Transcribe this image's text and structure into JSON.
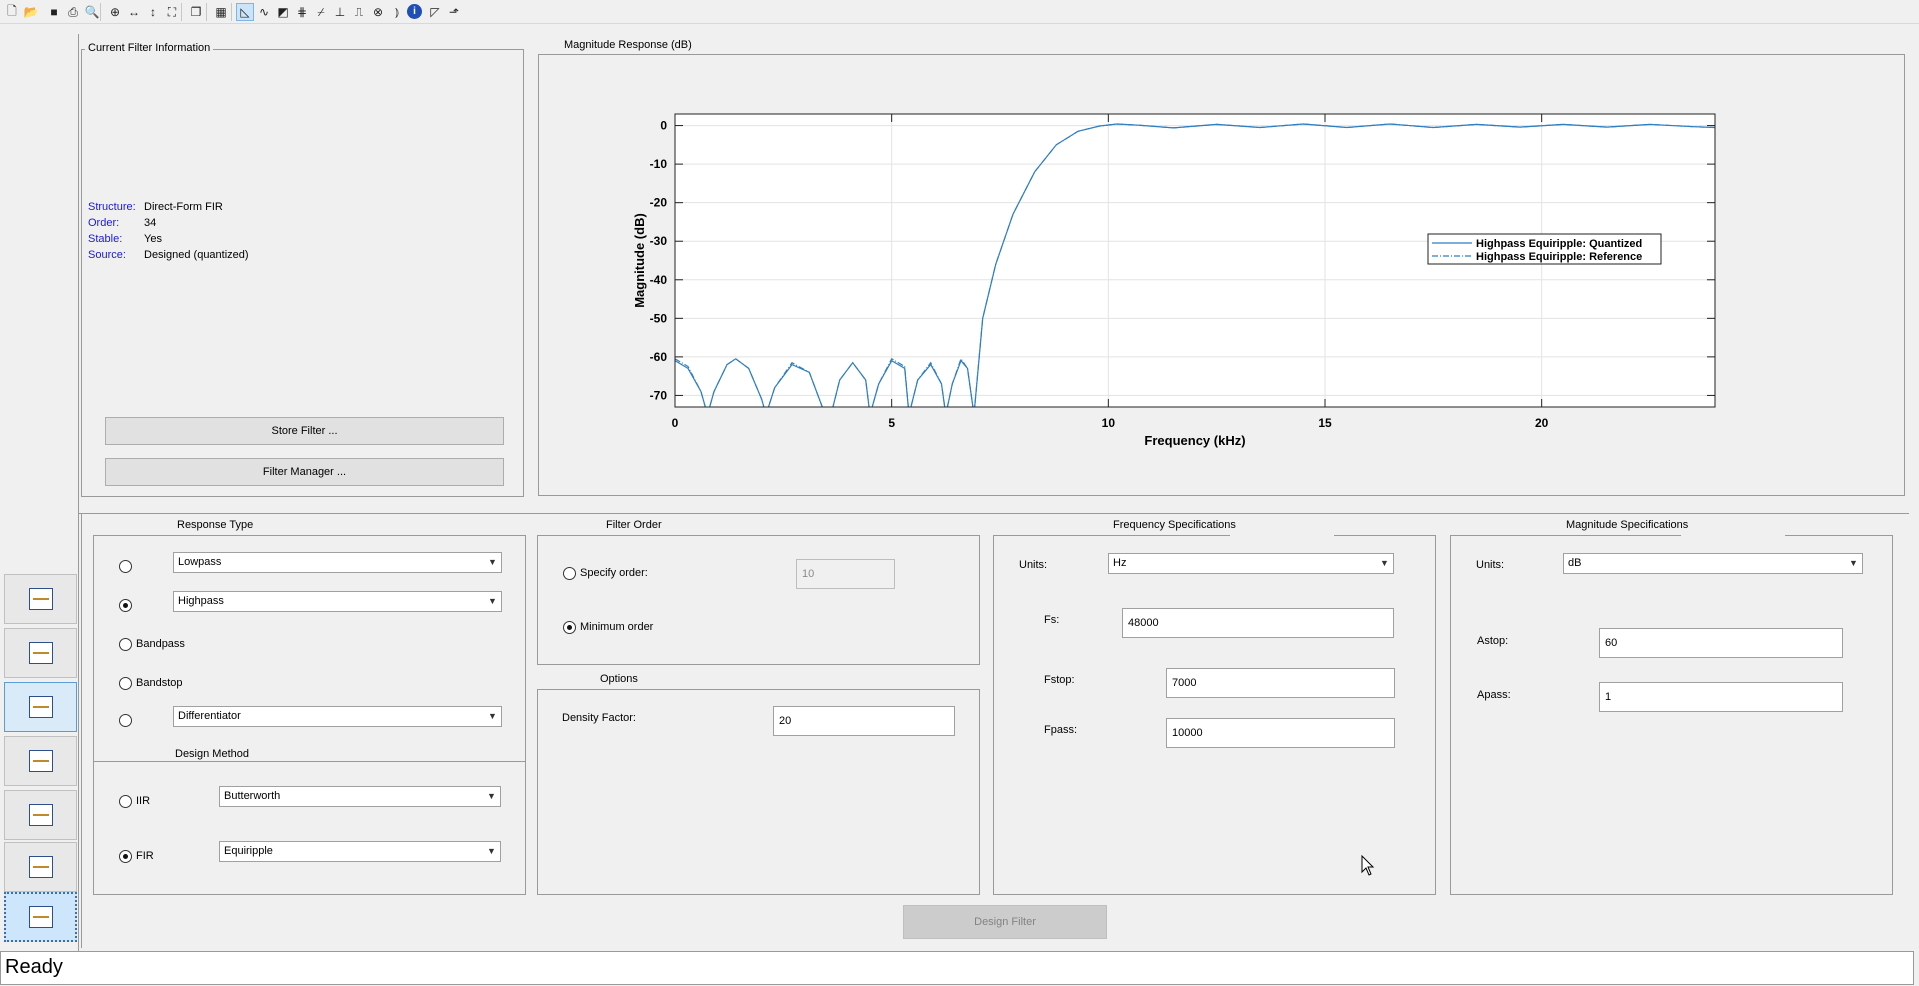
{
  "toolbar": {
    "icons": [
      "new-file-icon",
      "open-folder-icon",
      "save-icon",
      "print-icon",
      "print-preview-icon",
      "zoom-in-icon",
      "zoom-x-icon",
      "zoom-y-icon",
      "full-view-icon",
      "new-figure-icon",
      "filter-specs-icon",
      "magnitude-response-icon",
      "phase-response-icon",
      "magnitude-phase-icon",
      "group-delay-icon",
      "phase-delay-icon",
      "impulse-response-icon",
      "step-response-icon",
      "pole-zero-icon",
      "filter-coefficients-icon",
      "filter-information-icon",
      "magnitude-estimate-icon",
      "round-off-noise-icon"
    ]
  },
  "current_filter_info": {
    "title": "Current Filter Information",
    "rows": [
      {
        "label": "Structure:",
        "value": "Direct-Form FIR"
      },
      {
        "label": "Order:",
        "value": "34"
      },
      {
        "label": "Stable:",
        "value": "Yes"
      },
      {
        "label": "Source:",
        "value": "Designed (quantized)"
      }
    ],
    "store_filter": "Store Filter ...",
    "filter_manager": "Filter Manager ..."
  },
  "magnitude_panel": {
    "title": "Magnitude Response (dB)"
  },
  "chart_data": {
    "type": "line",
    "title": "",
    "xlabel": "Frequency (kHz)",
    "ylabel": "Magnitude (dB)",
    "xlim": [
      0,
      24
    ],
    "ylim": [
      -73,
      3
    ],
    "xticks": [
      0,
      5,
      10,
      15,
      20
    ],
    "yticks": [
      0,
      -10,
      -20,
      -30,
      -40,
      -50,
      -60,
      -70
    ],
    "grid": true,
    "legend_position": "right",
    "series": [
      {
        "name": "Highpass Equiripple: Quantized",
        "style": "solid",
        "color": "#2f7fc1",
        "x": [
          0,
          0.3,
          0.6,
          0.75,
          0.9,
          1.2,
          1.4,
          1.7,
          2.0,
          2.1,
          2.3,
          2.7,
          3.1,
          3.4,
          3.6,
          3.8,
          4.1,
          4.4,
          4.5,
          4.7,
          5.0,
          5.3,
          5.4,
          5.6,
          5.9,
          6.15,
          6.25,
          6.4,
          6.6,
          6.75,
          6.9,
          7.1,
          7.4,
          7.8,
          8.3,
          8.8,
          9.3,
          9.8,
          10.2,
          10.7,
          11.5,
          12.5,
          13.5,
          14.5,
          15.5,
          16.5,
          17.5,
          18.5,
          19.5,
          20.5,
          21.5,
          22.5,
          23.5,
          24
        ],
        "y": [
          -61,
          -63,
          -69,
          -75,
          -69,
          -62,
          -60.5,
          -63,
          -71,
          -75,
          -68,
          -62,
          -64,
          -73,
          -75,
          -66,
          -61.5,
          -66,
          -75,
          -67,
          -61,
          -63,
          -75,
          -66,
          -62,
          -67,
          -75,
          -67,
          -61,
          -63,
          -75,
          -50,
          -36,
          -23,
          -12,
          -5,
          -1.5,
          -0.1,
          0.4,
          0.1,
          -0.6,
          0.3,
          -0.5,
          0.4,
          -0.5,
          0.4,
          -0.5,
          0.3,
          -0.4,
          0.3,
          -0.4,
          0.3,
          -0.3,
          -0.5
        ]
      },
      {
        "name": "Highpass Equiripple: Reference",
        "style": "dashdot",
        "color": "#2f7fc1",
        "x": [
          0,
          0.3,
          0.6,
          0.75,
          0.9,
          1.2,
          1.4,
          1.7,
          2.0,
          2.1,
          2.3,
          2.7,
          3.1,
          3.4,
          3.6,
          3.8,
          4.1,
          4.4,
          4.5,
          4.7,
          5.0,
          5.3,
          5.4,
          5.6,
          5.9,
          6.15,
          6.25,
          6.4,
          6.6,
          6.75,
          6.9,
          7.1,
          7.4,
          7.8,
          8.3,
          8.8,
          9.3,
          9.8,
          10.2,
          10.7,
          11.5,
          12.5,
          13.5,
          14.5,
          15.5,
          16.5,
          17.5,
          18.5,
          19.5,
          20.5,
          21.5,
          22.5,
          23.5,
          24
        ],
        "y": [
          -60.5,
          -62.5,
          -69,
          -75,
          -69,
          -62,
          -60.5,
          -63,
          -71,
          -75,
          -68,
          -61.5,
          -64,
          -73,
          -75,
          -66,
          -61.5,
          -66,
          -75,
          -67,
          -60.5,
          -62.5,
          -75,
          -66,
          -61.5,
          -67,
          -75,
          -67,
          -60.5,
          -63,
          -75,
          -50,
          -36,
          -23,
          -12,
          -5,
          -1.5,
          -0.1,
          0.4,
          0.1,
          -0.6,
          0.3,
          -0.5,
          0.4,
          -0.5,
          0.4,
          -0.5,
          0.3,
          -0.4,
          0.3,
          -0.4,
          0.3,
          -0.3,
          -0.5
        ]
      }
    ]
  },
  "response_type": {
    "title": "Response Type",
    "lowpass": "Lowpass",
    "highpass": "Highpass",
    "bandpass": "Bandpass",
    "bandstop": "Bandstop",
    "differentiator": "Differentiator",
    "selected": "Highpass"
  },
  "design_method": {
    "title": "Design Method",
    "iir_label": "IIR",
    "iir_value": "Butterworth",
    "fir_label": "FIR",
    "fir_value": "Equiripple",
    "selected": "FIR"
  },
  "filter_order": {
    "title": "Filter Order",
    "specify_label": "Specify order:",
    "specify_value": "10",
    "minimum_label": "Minimum order",
    "selected": "Minimum order"
  },
  "options": {
    "title": "Options",
    "density_label": "Density Factor:",
    "density_value": "20"
  },
  "frequency_specs": {
    "title": "Frequency Specifications",
    "units_label": "Units:",
    "units_value": "Hz",
    "fs_label": "Fs:",
    "fs_value": "48000",
    "fstop_label": "Fstop:",
    "fstop_value": "7000",
    "fpass_label": "Fpass:",
    "fpass_value": "10000"
  },
  "magnitude_specs": {
    "title": "Magnitude Specifications",
    "units_label": "Units:",
    "units_value": "dB",
    "astop_label": "Astop:",
    "astop_value": "60",
    "apass_label": "Apass:",
    "apass_value": "1"
  },
  "design_button": "Design Filter",
  "status": "Ready"
}
